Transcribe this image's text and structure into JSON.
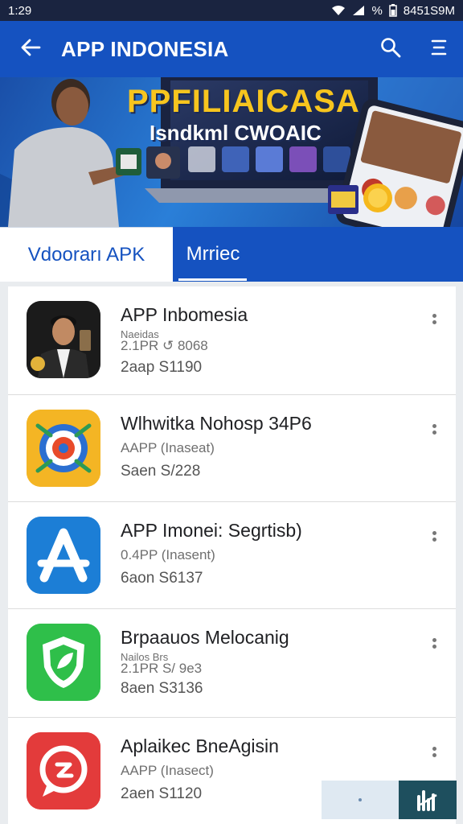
{
  "status_bar": {
    "time": "1:29",
    "battery": "%",
    "right_text": "8451S9M",
    "icons": [
      "wifi-icon",
      "signal-icon",
      "battery-icon"
    ]
  },
  "app_bar": {
    "title": "APP INDONESIA",
    "icons": [
      "back-arrow-icon",
      "search-icon",
      "menu-icon"
    ]
  },
  "banner": {
    "headline1": "PPFILIAICASA",
    "headline2": "Isndkml CWOAIC"
  },
  "tabs": [
    {
      "label": "Vdoorarı APK",
      "active": true
    },
    {
      "label": "Mrriec",
      "active": false
    }
  ],
  "apps": [
    {
      "name": "APP Inbomesia",
      "line1": "Naeidas",
      "line2": "2.1PR  ↺ 8068",
      "line3": "2aap  S1190",
      "icon": "person-icon",
      "icon_color": "#222222"
    },
    {
      "name": "Wlhwitka Nohosp 34P6",
      "line1": "",
      "line2": "AAPP (Inaseat)",
      "line3": "Saen  S/228",
      "icon": "target-icon",
      "icon_color": "#f4b524"
    },
    {
      "name": "APP Imonei: Segrtisb)",
      "line1": "",
      "line2": "0.4PP (Inasent)",
      "line3": "6aon  S6137",
      "icon": "letter-a-icon",
      "icon_color": "#1c7ed6"
    },
    {
      "name": "Brpaauos Melocanig",
      "line1": "Nailos  Brs",
      "line2": "2.1PR  S/ 9e3",
      "line3": "8aen  S3136",
      "icon": "shield-leaf-icon",
      "icon_color": "#2fbf4a"
    },
    {
      "name": "Aplaikec BneAgisin",
      "line1": "",
      "line2": "AAPP (Inasect)",
      "line3": "2aen  S1120",
      "icon": "chat-bubble-icon",
      "icon_color": "#e33b3b"
    }
  ],
  "colors": {
    "primary": "#1552c0",
    "status_bar": "#1a2440",
    "accent_yellow": "#f7c51e"
  }
}
